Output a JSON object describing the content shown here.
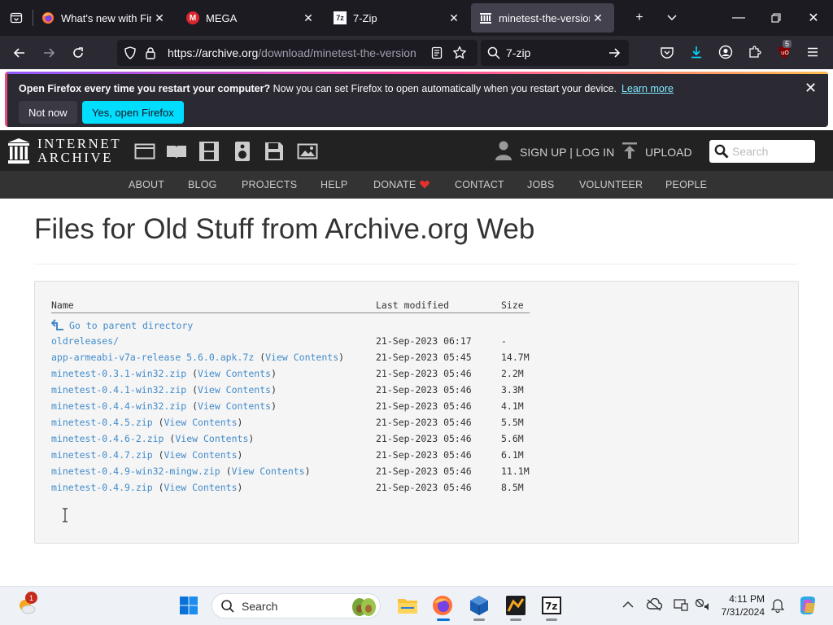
{
  "browser": {
    "tabs": [
      {
        "title": "What's new with Firefo",
        "icon": "firefox-icon",
        "active": false
      },
      {
        "title": "MEGA",
        "icon": "mega-icon",
        "active": false
      },
      {
        "title": "7-Zip",
        "icon": "7zip-icon",
        "active": false
      },
      {
        "title": "minetest-the-versions",
        "icon": "archive-icon",
        "active": true
      }
    ],
    "url_host": "https://archive.org",
    "url_path": "/download/minetest-the-version",
    "search_value": "7-zip",
    "extension_badge": "5"
  },
  "notification": {
    "bold": "Open Firefox every time you restart your computer?",
    "text": " Now you can set Firefox to open automatically when you restart your device.",
    "link": "Learn more",
    "not_now": "Not now",
    "yes": "Yes, open Firefox"
  },
  "ia": {
    "logo_line1": "INTERNET",
    "logo_line2": "ARCHIVE",
    "signup": "SIGN UP | LOG IN",
    "upload": "UPLOAD",
    "search_placeholder": "Search",
    "nav": [
      "ABOUT",
      "BLOG",
      "PROJECTS",
      "HELP",
      "DONATE",
      "CONTACT",
      "JOBS",
      "VOLUNTEER",
      "PEOPLE"
    ]
  },
  "page": {
    "title": "Files for Old Stuff from Archive.org Web",
    "columns": {
      "name": "Name",
      "modified": "Last modified",
      "size": "Size"
    },
    "parent": "Go to parent directory",
    "view_contents": "View Contents",
    "files": [
      {
        "name": "oldreleases/",
        "date": "21-Sep-2023 06:17",
        "size": "-",
        "contents": false
      },
      {
        "name": "app-armeabi-v7a-release 5.6.0.apk.7z",
        "date": "21-Sep-2023 05:45",
        "size": "14.7M",
        "contents": true
      },
      {
        "name": "minetest-0.3.1-win32.zip",
        "date": "21-Sep-2023 05:46",
        "size": "2.2M",
        "contents": true
      },
      {
        "name": "minetest-0.4.1-win32.zip",
        "date": "21-Sep-2023 05:46",
        "size": "3.3M",
        "contents": true
      },
      {
        "name": "minetest-0.4.4-win32.zip",
        "date": "21-Sep-2023 05:46",
        "size": "4.1M",
        "contents": true
      },
      {
        "name": "minetest-0.4.5.zip",
        "date": "21-Sep-2023 05:46",
        "size": "5.5M",
        "contents": true
      },
      {
        "name": "minetest-0.4.6-2.zip",
        "date": "21-Sep-2023 05:46",
        "size": "5.6M",
        "contents": true
      },
      {
        "name": "minetest-0.4.7.zip",
        "date": "21-Sep-2023 05:46",
        "size": "6.1M",
        "contents": true
      },
      {
        "name": "minetest-0.4.9-win32-mingw.zip",
        "date": "21-Sep-2023 05:46",
        "size": "11.1M",
        "contents": true
      },
      {
        "name": "minetest-0.4.9.zip",
        "date": "21-Sep-2023 05:46",
        "size": "8.5M",
        "contents": true
      }
    ]
  },
  "taskbar": {
    "search_label": "Search",
    "weather_badge": "1",
    "time": "4:11 PM",
    "date": "7/31/2024"
  },
  "colors": {
    "accent": "#00ddff",
    "link": "#428bca",
    "donate_heart": "#e5312d"
  }
}
